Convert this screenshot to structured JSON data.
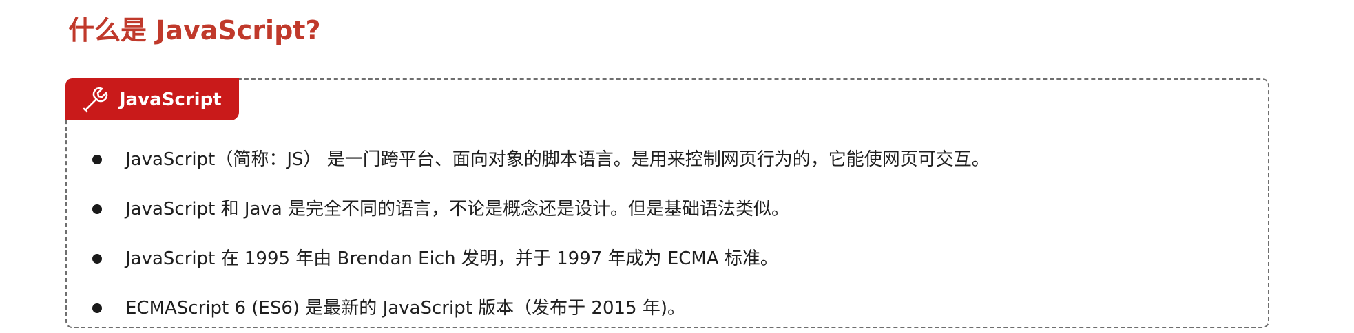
{
  "page": {
    "title": "什么是 JavaScript?"
  },
  "tag": {
    "icon": "wrench-icon",
    "label": "JavaScript",
    "color": "#c91a1a"
  },
  "colors": {
    "title": "#c0392b",
    "border": "#6f6f6f",
    "text": "#1f1f1f"
  },
  "bullets": [
    "JavaScript（简称：JS） 是一门跨平台、面向对象的脚本语言。是用来控制网页行为的，它能使网页可交互。",
    "JavaScript 和 Java 是完全不同的语言，不论是概念还是设计。但是基础语法类似。",
    "JavaScript 在 1995 年由 Brendan Eich 发明，并于 1997 年成为 ECMA 标准。",
    "ECMAScript 6 (ES6) 是最新的 JavaScript 版本（发布于 2015 年)。"
  ]
}
